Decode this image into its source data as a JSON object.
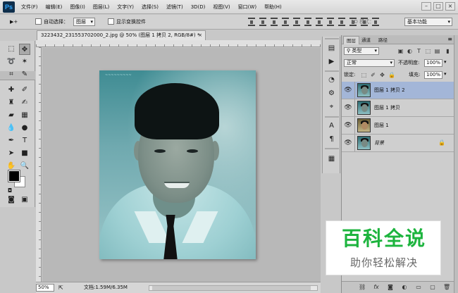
{
  "app": {
    "logo": "Ps"
  },
  "menu": [
    "文件(F)",
    "编辑(E)",
    "图像(I)",
    "图层(L)",
    "文字(Y)",
    "选择(S)",
    "滤镜(T)",
    "3D(D)",
    "视图(V)",
    "窗口(W)",
    "帮助(H)"
  ],
  "window_controls": {
    "minimize": "–",
    "maximize": "□",
    "close": "×"
  },
  "options_bar": {
    "tool_glyph": "▶+",
    "auto_select_label": "自动选择：",
    "auto_select_value": "图层",
    "show_transform_label": "显示变换控件",
    "mode_3d_label": "3D 模式：",
    "workspace": "基本功能"
  },
  "document": {
    "tab_title": "3223432_231553702000_2.jpg @ 50% (图层 1 拷贝 2, RGB/8#) *",
    "close_glyph": "×",
    "image_corner_text": "~~~~~~~~~"
  },
  "status_bar": {
    "zoom": "50%",
    "doc_info": "文档:1.59M/6.35M"
  },
  "layers_panel": {
    "tabs": [
      "图层",
      "通道",
      "路径"
    ],
    "active_tab": 0,
    "filter_kind": "类型",
    "blend_mode": "正常",
    "opacity_label": "不透明度:",
    "opacity_value": "100%",
    "lock_label": "锁定:",
    "fill_label": "填充:",
    "fill_value": "100%",
    "layers": [
      {
        "name": "图层 1 拷贝 2",
        "visible": true,
        "selected": true,
        "thumb": "cool",
        "locked": false
      },
      {
        "name": "图层 1 拷贝",
        "visible": true,
        "selected": false,
        "thumb": "cool",
        "locked": false
      },
      {
        "name": "图层 1",
        "visible": true,
        "selected": false,
        "thumb": "warm",
        "locked": false
      },
      {
        "name": "背景",
        "visible": true,
        "selected": false,
        "thumb": "cool",
        "locked": true
      }
    ],
    "footer_icons": [
      "link-icon",
      "fx-icon",
      "mask-icon",
      "adjustment-icon",
      "folder-icon",
      "new-layer-icon",
      "trash-icon"
    ]
  },
  "watermark": {
    "title": "百科全说",
    "subtitle": "助你轻松解决"
  },
  "colors": {
    "selected_layer": "#a3b6d8",
    "foreground": "#000000",
    "background": "#ffffff",
    "watermark_green": "#1db43e"
  }
}
